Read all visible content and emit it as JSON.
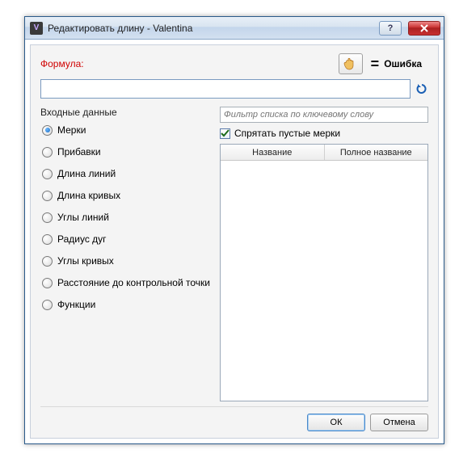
{
  "window": {
    "title": "Редактировать длину - Valentina",
    "app_icon_letter": "V"
  },
  "formula": {
    "label": "Формула:",
    "value": "",
    "error_label": "Ошибка",
    "equals": "="
  },
  "left": {
    "group_title": "Входные данные",
    "radios": [
      {
        "label": "Мерки",
        "checked": true
      },
      {
        "label": "Прибавки",
        "checked": false
      },
      {
        "label": "Длина линий",
        "checked": false
      },
      {
        "label": "Длина кривых",
        "checked": false
      },
      {
        "label": "Углы линий",
        "checked": false
      },
      {
        "label": "Радиус дуг",
        "checked": false
      },
      {
        "label": "Углы кривых",
        "checked": false
      },
      {
        "label": "Расстояние до контрольной точки",
        "checked": false
      },
      {
        "label": "Функции",
        "checked": false
      }
    ]
  },
  "right": {
    "filter_placeholder": "Фильтр списка по ключевому слову",
    "hide_empty_label": "Спрятать пустые мерки",
    "hide_empty_checked": true,
    "columns": [
      "Название",
      "Полное название"
    ]
  },
  "buttons": {
    "ok": "ОК",
    "cancel": "Отмена"
  }
}
